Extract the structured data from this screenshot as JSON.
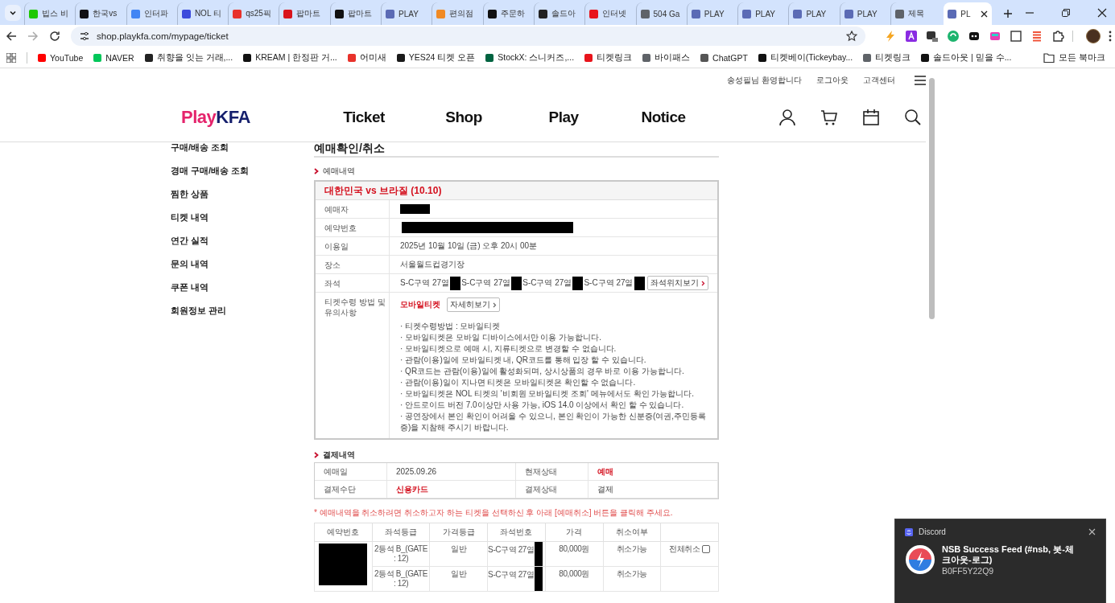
{
  "browser": {
    "tabs": [
      {
        "label": "빕스 비",
        "color": "#1ec800",
        "selected": false
      },
      {
        "label": "한국vs",
        "color": "#111111",
        "selected": false
      },
      {
        "label": "인터파",
        "color": "#4285f4",
        "selected": false
      },
      {
        "label": "NOL 티",
        "color": "#3c4bdc",
        "selected": false
      },
      {
        "label": "qs25픽",
        "color": "#e8322b",
        "selected": false
      },
      {
        "label": "팝마트",
        "color": "#d9141b",
        "selected": false
      },
      {
        "label": "팝마트",
        "color": "#111111",
        "selected": false
      },
      {
        "label": "PLAY",
        "color": "#5b6bb5",
        "selected": false
      },
      {
        "label": "편의점",
        "color": "#f08a24",
        "selected": false
      },
      {
        "label": "주문하",
        "color": "#111111",
        "selected": false
      },
      {
        "label": "솔드아",
        "color": "#222222",
        "selected": false
      },
      {
        "label": "인터넷",
        "color": "#e8141b",
        "selected": false
      },
      {
        "label": "504 Ga",
        "color": "#5f6368",
        "selected": false
      },
      {
        "label": "PLAY",
        "color": "#5b6bb5",
        "selected": false
      },
      {
        "label": "PLAY",
        "color": "#5b6bb5",
        "selected": false
      },
      {
        "label": "PLAY",
        "color": "#5b6bb5",
        "selected": false
      },
      {
        "label": "PLAY",
        "color": "#5b6bb5",
        "selected": false
      },
      {
        "label": "제목",
        "color": "#5f6368",
        "selected": false
      },
      {
        "label": "PL",
        "color": "#5b6bb5",
        "selected": true
      }
    ],
    "url": "shop.playkfa.com/mypage/ticket",
    "bookmarks": [
      {
        "label": "YouTube",
        "color": "#ff0000"
      },
      {
        "label": "NAVER",
        "color": "#03c75a"
      },
      {
        "label": "취향을 잇는 거래,...",
        "color": "#222222"
      },
      {
        "label": "KREAM | 한정판 거...",
        "color": "#111111"
      },
      {
        "label": "어미새",
        "color": "#e8322b"
      },
      {
        "label": "YES24 티켓 오픈",
        "color": "#1a1a1a"
      },
      {
        "label": "StockX: 스니커즈,...",
        "color": "#006340"
      },
      {
        "label": "티켓링크",
        "color": "#e8141b"
      },
      {
        "label": "바이패스",
        "color": "#5f6368"
      },
      {
        "label": "ChatGPT",
        "color": "#555555"
      },
      {
        "label": "티켓베이(Tickeybay...",
        "color": "#111111"
      },
      {
        "label": "티켓링크",
        "color": "#5f6368"
      },
      {
        "label": "솔드아웃 | 믿을 수...",
        "color": "#111111"
      }
    ],
    "all_bookmarks": "모든 북마크"
  },
  "header": {
    "utility_links": [
      "송성필님 환영합니다",
      "로그아웃",
      "고객센터"
    ],
    "logo": {
      "first": "Play",
      "second": "KFA"
    },
    "nav": [
      "Ticket",
      "Shop",
      "Play",
      "Notice"
    ]
  },
  "sidebar": {
    "items": [
      "구매/배송 조회",
      "경매 구매/배송 조회",
      "찜한 상품",
      "티켓 내역",
      "연간 실적",
      "문의 내역",
      "쿠폰 내역",
      "회원정보 관리"
    ]
  },
  "main": {
    "title": "예매확인/취소",
    "booking": {
      "heading": "예매내역",
      "event": "대한민국 vs 브라질 (10.10)",
      "rows": [
        {
          "kind": "redacted",
          "label": "예매자"
        },
        {
          "kind": "redacted",
          "label": "예약번호"
        },
        {
          "kind": "text",
          "label": "이용일",
          "value": "2025년 10월 10일 (금) 오후 20시 00분"
        },
        {
          "kind": "text",
          "label": "장소",
          "value": "서울월드컵경기장"
        },
        {
          "kind": "seats",
          "label": "좌석",
          "seats": [
            "S-C구역 27열",
            "S-C구역 27열",
            "S-C구역 27열",
            "S-C구역 27열"
          ],
          "button": "좌석위치보기"
        },
        {
          "kind": "notes",
          "label": "티켓수령 방법 및 유의사항",
          "method": "모바일티켓",
          "button": "자세히보기",
          "notes": [
            "· 티켓수령방법 : 모바일티켓",
            "· 모바일티켓은 모바일 디바이스에서만 이용 가능합니다.",
            "· 모바일티켓으로 예매 시, 지류티켓으로 변경할 수 없습니다.",
            "· 관람(이용)일에 모바일티켓 내, QR코드를 통해 입장 할 수 있습니다.",
            "· QR코드는 관람(이용)일에 활성화되며, 상시상품의 경우 바로 이용 가능합니다.",
            "· 관람(이용)일이 지나면 티켓은 모바일티켓은 확인할 수 없습니다.",
            "· 모바일티켓은 NOL 티켓의 '비회원 모바일티켓 조회' 메뉴에서도 확인 가능합니다.",
            "· 안드로이드 버전 7.0이상만 사용 가능, iOS 14.0 이상에서 확인 할 수 있습니다.",
            "· 공연장에서 본인 확인이 어려울 수 있으니, 본인 확인이 가능한 신분증(여권,주민등록증)을 지참해 주시기 바랍니다."
          ]
        }
      ]
    },
    "payment": {
      "heading": "결제내역",
      "cells": [
        {
          "label": "예매일",
          "value": "2025.09.26",
          "emphasis": false
        },
        {
          "label": "현재상태",
          "value": "예매",
          "emphasis": true
        },
        {
          "label": "결제수단",
          "value": "신용카드",
          "emphasis": true
        },
        {
          "label": "결제상태",
          "value": "결제",
          "emphasis": false
        }
      ]
    },
    "cancel_notice": "* 예매내역을 취소하려면 취소하고자 하는 티켓을 선택하신 후 아래 [예매취소] 버튼을 클릭해 주세요.",
    "tickets": {
      "columns": [
        "예약번호",
        "좌석등급",
        "가격등급",
        "좌석번호",
        "가격",
        "취소여부"
      ],
      "rows": [
        {
          "grade": "2등석 B_(GATE : 12)",
          "price_grade": "일반",
          "seat": "S-C구역 27열",
          "price": "80,000원",
          "status": "취소가능",
          "cancel_all": {
            "label": "전체취소",
            "checked": false
          }
        },
        {
          "grade": "2등석 B_(GATE : 12)",
          "price_grade": "일반",
          "seat": "S-C구역 27열",
          "price": "80,000원",
          "status": "취소가능"
        }
      ]
    }
  },
  "notification": {
    "app": "Discord",
    "title": "NSB Success Feed (#nsb, 봇-체크아웃-로그)",
    "body": "B0FF5Y22Q9"
  }
}
